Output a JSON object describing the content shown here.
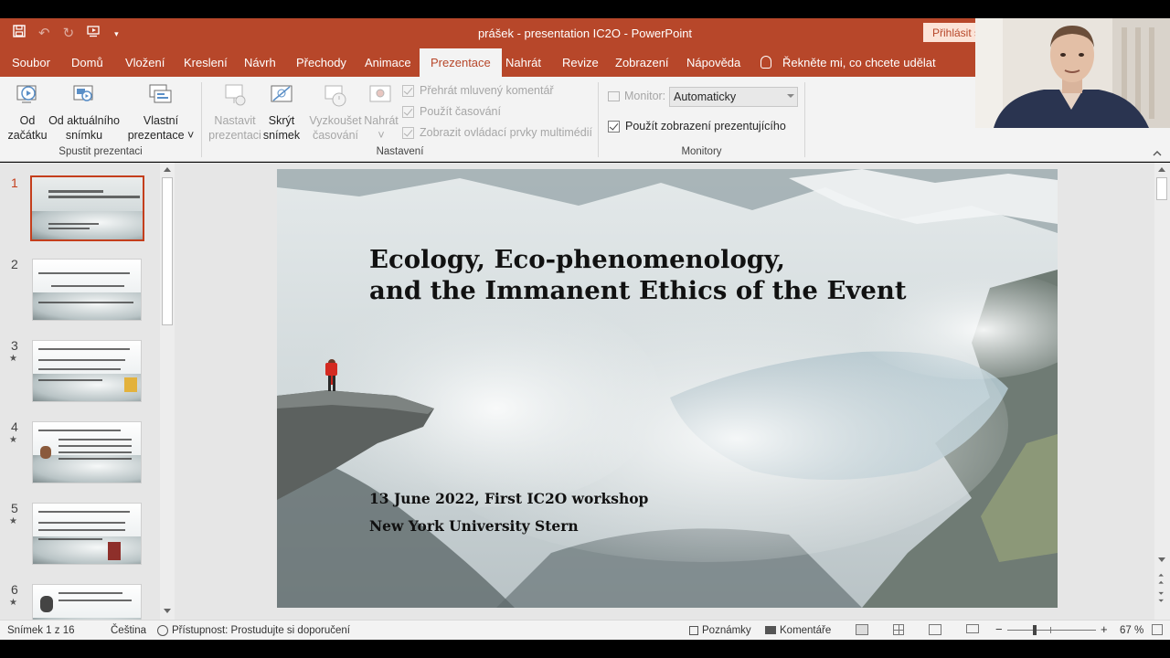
{
  "window": {
    "title": "prášek - presentation IC2O  -  PowerPoint",
    "sign_in": "Přihlásit s"
  },
  "tabs": [
    "Soubor",
    "Domů",
    "Vložení",
    "Kreslení",
    "Návrh",
    "Přechody",
    "Animace",
    "Prezentace",
    "Nahrát",
    "Revize",
    "Zobrazení",
    "Nápověda"
  ],
  "active_tab": "Prezentace",
  "tell_me": "Řekněte mi, co chcete udělat",
  "ribbon": {
    "start_group": {
      "label": "Spustit prezentaci",
      "from_start": [
        "Od",
        "začátku"
      ],
      "from_current": [
        "Od aktuálního",
        "snímku"
      ],
      "custom": [
        "Vlastní",
        "prezentace ˅"
      ]
    },
    "setup_group": {
      "label": "Nastavení",
      "setup_show": [
        "Nastavit",
        "prezentaci"
      ],
      "hide_slide": [
        "Skrýt",
        "snímek"
      ],
      "rehearse": [
        "Vyzkoušet",
        "časování"
      ],
      "record": [
        "Nahrát",
        "˅"
      ],
      "play_narration": "Přehrát mluvený komentář",
      "use_timings": "Použít časování",
      "show_controls": "Zobrazit ovládací prvky multimédií"
    },
    "monitors_group": {
      "label": "Monitory",
      "monitor_label": "Monitor:",
      "monitor_value": "Automaticky",
      "presenter_view": "Použít zobrazení prezentujícího"
    }
  },
  "thumbnails": [
    {
      "num": "1",
      "star": "",
      "selected": true
    },
    {
      "num": "2",
      "star": "",
      "selected": false
    },
    {
      "num": "3",
      "star": "★",
      "selected": false
    },
    {
      "num": "4",
      "star": "★",
      "selected": false
    },
    {
      "num": "5",
      "star": "★",
      "selected": false
    },
    {
      "num": "6",
      "star": "★",
      "selected": false
    }
  ],
  "slide": {
    "title_line1": "Ecology, Eco-phenomenology,",
    "title_line2": "and the Immanent Ethics of the Event",
    "date_line": "13 June 2022, First IC2O workshop",
    "venue_line": "New York University Stern"
  },
  "status": {
    "slide_info": "Snímek 1 z 16",
    "language": "Čeština",
    "accessibility": "Přístupnost: Prostudujte si doporučení",
    "notes": "Poznámky",
    "comments": "Komentáře",
    "zoom": "67 %"
  },
  "colors": {
    "accent": "#b7472a",
    "selected_thumb": "#c43e1c",
    "ribbon_bg": "#f3f3f3"
  }
}
